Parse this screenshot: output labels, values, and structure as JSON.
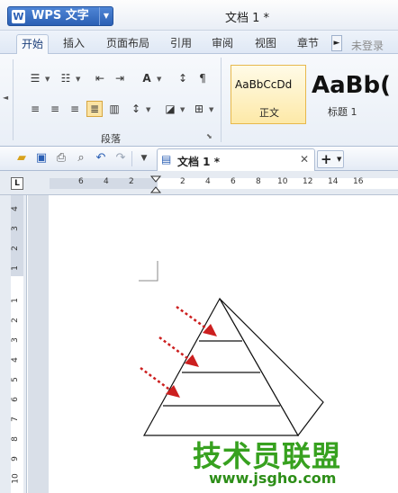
{
  "title_bar": {
    "app_name": "WPS 文字",
    "app_logo": "W",
    "document_title": "文档 1 *"
  },
  "ribbon_tabs": [
    "开始",
    "插入",
    "页面布局",
    "引用",
    "审阅",
    "视图",
    "章节"
  ],
  "active_tab": "开始",
  "login": "未登录",
  "ribbon": {
    "paragraph_group_label": "段落",
    "styles": [
      {
        "sample": "AaBbCcDd",
        "name": "正文"
      },
      {
        "sample": "AaBb(",
        "name": "标题 1"
      }
    ]
  },
  "document_tab": {
    "label": "文档 1 *"
  },
  "horizontal_ruler_labels": [
    "6",
    "4",
    "2",
    "2",
    "4",
    "6",
    "8",
    "10",
    "12",
    "14",
    "16"
  ],
  "vertical_ruler_labels": [
    "4",
    "3",
    "2",
    "1",
    "1",
    "2",
    "3",
    "4",
    "5",
    "6",
    "7",
    "8",
    "9",
    "10"
  ],
  "ruler_corner": "L",
  "watermark": {
    "main": "技术员联盟",
    "sub": "www.jsgho.com"
  },
  "colors": {
    "accent": "#2b5fb4",
    "arrow": "#cc1f1f",
    "watermark": "#37a11f"
  }
}
